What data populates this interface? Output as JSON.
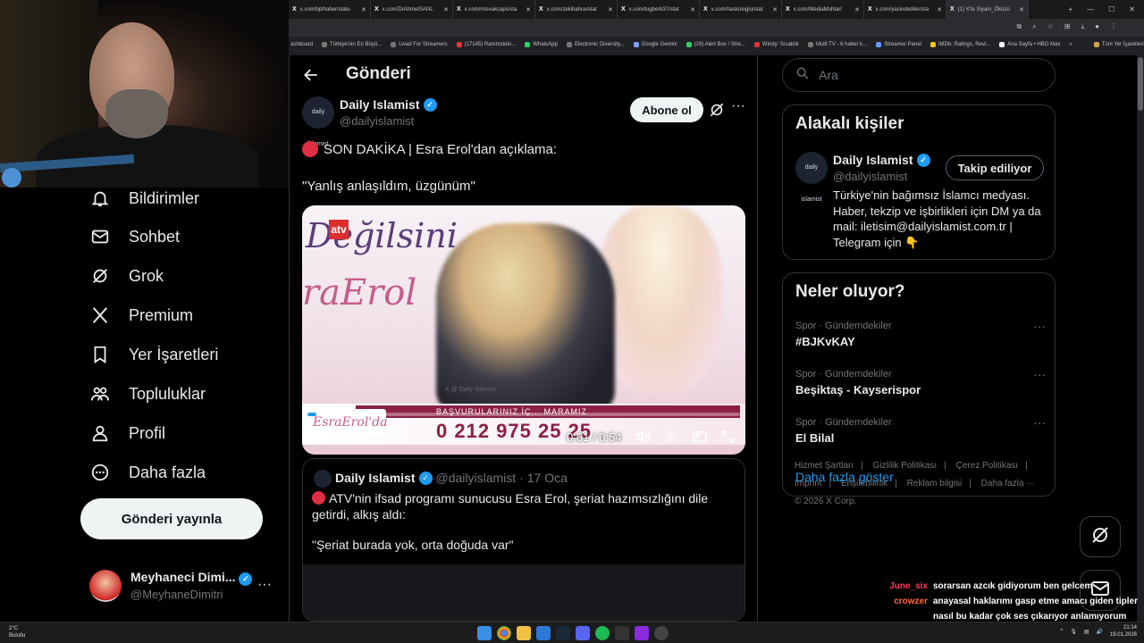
{
  "browser": {
    "tabs": [
      {
        "label": "x.com/bpthaber/statu"
      },
      {
        "label": "x.com/DrAhmetSANL"
      },
      {
        "label": "x.com/misvakcaps/sta"
      },
      {
        "label": "x.com/zekibahce/stat"
      },
      {
        "label": "x.com/tugberk37/stat"
      },
      {
        "label": "x.com/haskologlu/stat"
      },
      {
        "label": "x.com/MediaMuhtar/"
      },
      {
        "label": "x.com/yasindediler/sta"
      },
      {
        "label": "(1) X'te Siyam_Öküzü"
      }
    ],
    "bookmarks": [
      {
        "label": "ashboard"
      },
      {
        "label": "Türkiye'nin En Büyü..."
      },
      {
        "label": "Livad For Streamers"
      },
      {
        "label": "(17145) Rammstein..."
      },
      {
        "label": "WhatsApp"
      },
      {
        "label": "Electronic Diversity..."
      },
      {
        "label": "Google Gemini"
      },
      {
        "label": "(19) Alert Box / Stre..."
      },
      {
        "label": "Windy: Sıcaklık"
      },
      {
        "label": "Multi TV - 6 haber k..."
      },
      {
        "label": "Streamer Panel"
      },
      {
        "label": "IMDb: Ratings, Revi..."
      },
      {
        "label": "Ana Sayfa • HBO Max"
      },
      {
        "label": "»"
      },
      {
        "label": "Tüm Yer İşaretleri"
      }
    ]
  },
  "nav": {
    "items": [
      {
        "label": "Bildirimler",
        "icon": "bell-icon"
      },
      {
        "label": "Sohbet",
        "icon": "mail-icon"
      },
      {
        "label": "Grok",
        "icon": "grok-icon"
      },
      {
        "label": "Premium",
        "icon": "x-logo-icon"
      },
      {
        "label": "Yer İşaretleri",
        "icon": "bookmark-icon"
      },
      {
        "label": "Topluluklar",
        "icon": "people-icon"
      },
      {
        "label": "Profil",
        "icon": "person-icon"
      },
      {
        "label": "Daha fazla",
        "icon": "more-circle-icon"
      }
    ],
    "post_button": "Gönderi yayınla",
    "account": {
      "name": "Meyhaneci Dimi...",
      "handle": "@MeyhaneDimitri"
    }
  },
  "main": {
    "header_title": "Gönderi",
    "author": {
      "name": "Daily Islamist",
      "handle": "@dailyislamist",
      "avatar_text": "daily islamist"
    },
    "subscribe_label": "Abone ol",
    "text1": "SON DAKİKA | Esra Erol'dan açıklama:",
    "text2": "\"Yanlış anlaşıldım, üzgünüm\"",
    "video": {
      "current_time": "0:01",
      "duration": "0:54",
      "time_display": "0:01 / 0:54",
      "progress": 0.02,
      "overlay_title": "Değilsini",
      "overlay_name": "raErol",
      "banner_text": "BAŞVURULARINIZ İÇ...                 MARAMIZ",
      "show_logo": "EsraErol'da",
      "phone": "0 212 975 25 25",
      "channel": "atv",
      "watermark": "X @ Daily Islamist"
    },
    "quote": {
      "name": "Daily Islamist",
      "handle": "@dailyislamist",
      "date": "· 17 Oca",
      "text1": "ATV'nin ifsad programı sunucusu Esra Erol, şeriat hazımsızlığını dile getirdi, alkış aldı:",
      "text2": "\"Şeriat burada yok, orta doğuda var\""
    }
  },
  "sidebar": {
    "search_placeholder": "Ara",
    "related_title": "Alakalı kişiler",
    "related": {
      "name": "Daily Islamist",
      "handle": "@dailyislamist",
      "follow_label": "Takip ediliyor",
      "bio": "Türkiye'nin bağımsız İslamcı medyası. Haber, tekzip ve işbirlikleri için DM ya da mail: iletisim@dailyislamist.com.tr | Telegram için 👇"
    },
    "trends_title": "Neler oluyor?",
    "trends": [
      {
        "category": "Spor · Gündemdekiler",
        "title": "#BJKvKAY"
      },
      {
        "category": "Spor · Gündemdekiler",
        "title": "Beşiktaş - Kayserispor"
      },
      {
        "category": "Spor · Gündemdekiler",
        "title": "El Bilal"
      }
    ],
    "show_more": "Daha fazla göster",
    "footer": [
      "Hizmet Şartları",
      "|",
      "Gizlilik Politikası",
      "|",
      "Çerez Politikası",
      "|",
      "Imprint",
      "|",
      "Erişilebilirlik",
      "|",
      "Reklam bilgisi",
      "|",
      "Daha fazla ···",
      "© 2026 X Corp."
    ]
  },
  "chat": [
    {
      "user": "June_six",
      "msg": "sorarsan azcık gidiyorum ben gelcem"
    },
    {
      "user": "crowzer",
      "msg": "anayasal haklarımı gasp etme amacı giden tipler nasıl bu kadar çok ses çıkarıyor anlamıyorum"
    }
  ],
  "taskbar": {
    "weather_temp": "2°C",
    "weather_desc": "Bulutlu",
    "time": "21:14",
    "date": "19.01.2026"
  },
  "colors": {
    "accent": "#1d9bf0",
    "background": "#000000",
    "red_dot": "#dd2e44"
  }
}
